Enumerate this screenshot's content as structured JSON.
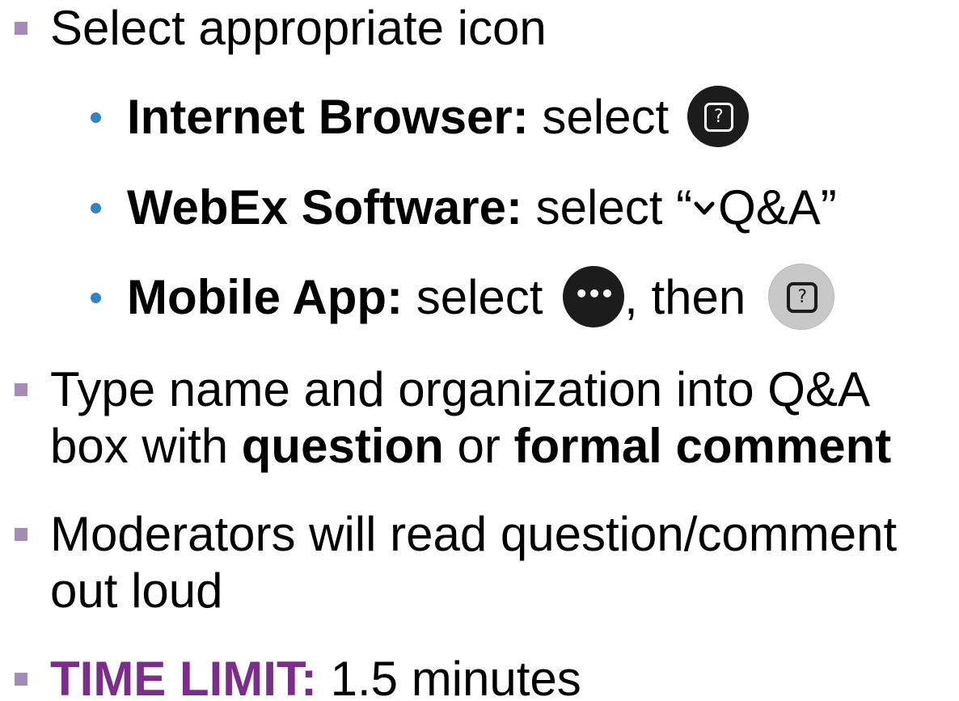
{
  "bullets": {
    "select_icon": "Select appropriate icon",
    "browser_label": "Internet Browser:",
    "browser_text": " select ",
    "software_label": "WebEx Software:",
    "software_text": " select “",
    "software_qa": "Q&A”",
    "mobile_label": "Mobile App:",
    "mobile_text": " select ",
    "mobile_then": ", then",
    "type_line1": "Type name and organization into Q&A",
    "type_line2_pre": "box with ",
    "type_question": "question",
    "type_or": " or ",
    "type_formal": "formal comment",
    "moderators_line1": "Moderators will read question/comment",
    "moderators_line2": "out loud",
    "time_label": "TIME LIMIT:",
    "time_value": " 1.5 minutes"
  },
  "icons": {
    "qa_icon_glyph": "?",
    "more_icon_glyph": "•••"
  },
  "colors": {
    "square_bullet": "#a58cb8",
    "dot_bullet": "#2e86c1",
    "time_limit": "#7b2d8b",
    "icon_dark": "#1c1c1c",
    "icon_light": "#c8c8c8"
  }
}
